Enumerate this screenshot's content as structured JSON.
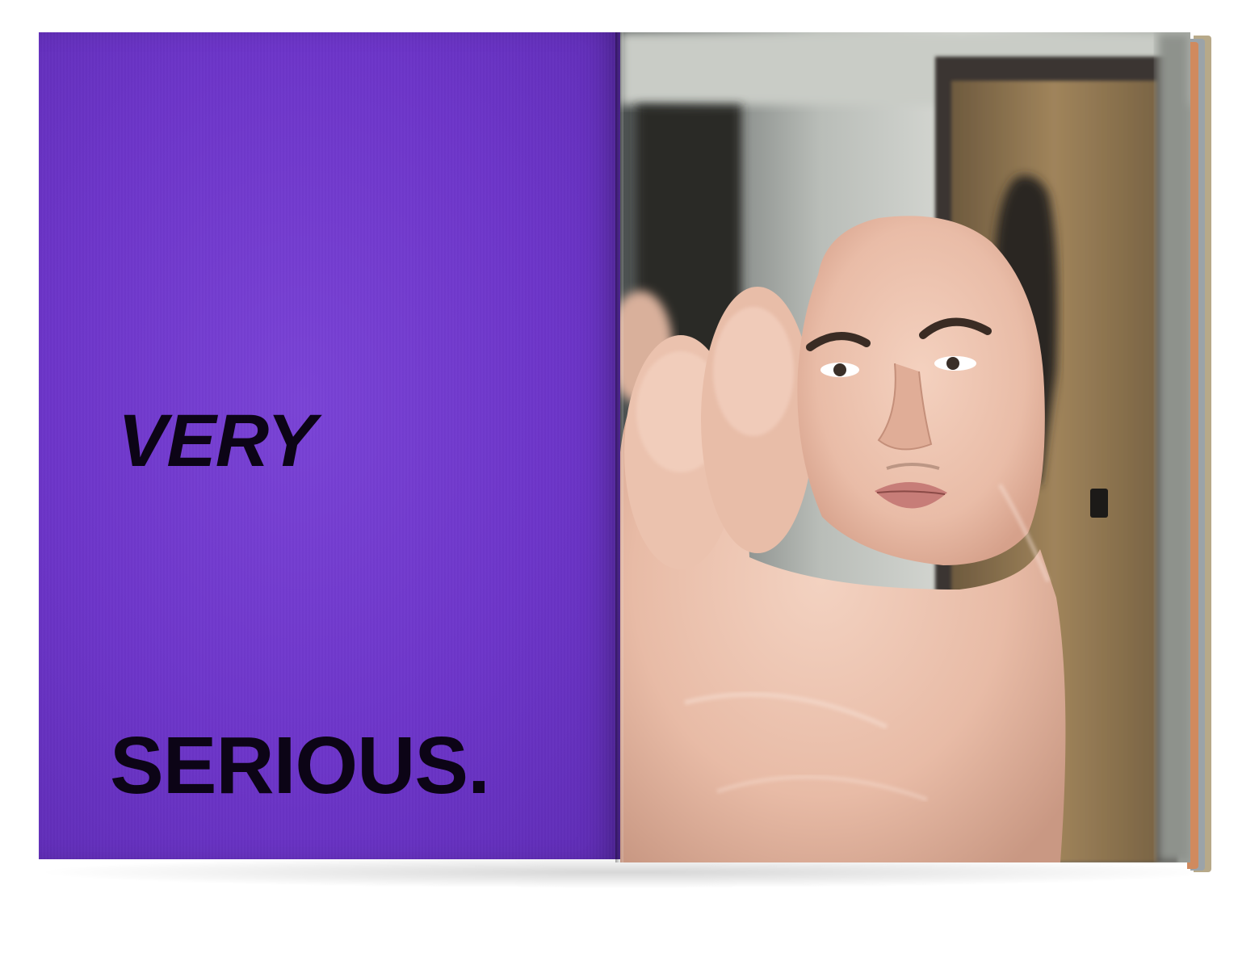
{
  "spread": {
    "left_page": {
      "background_color": "#6d35c9",
      "text_color": "#0c0416",
      "words": {
        "first": "VERY",
        "second": "SERIOUS."
      }
    },
    "right_page": {
      "photo_subject": "face-on-foot-photo"
    }
  }
}
